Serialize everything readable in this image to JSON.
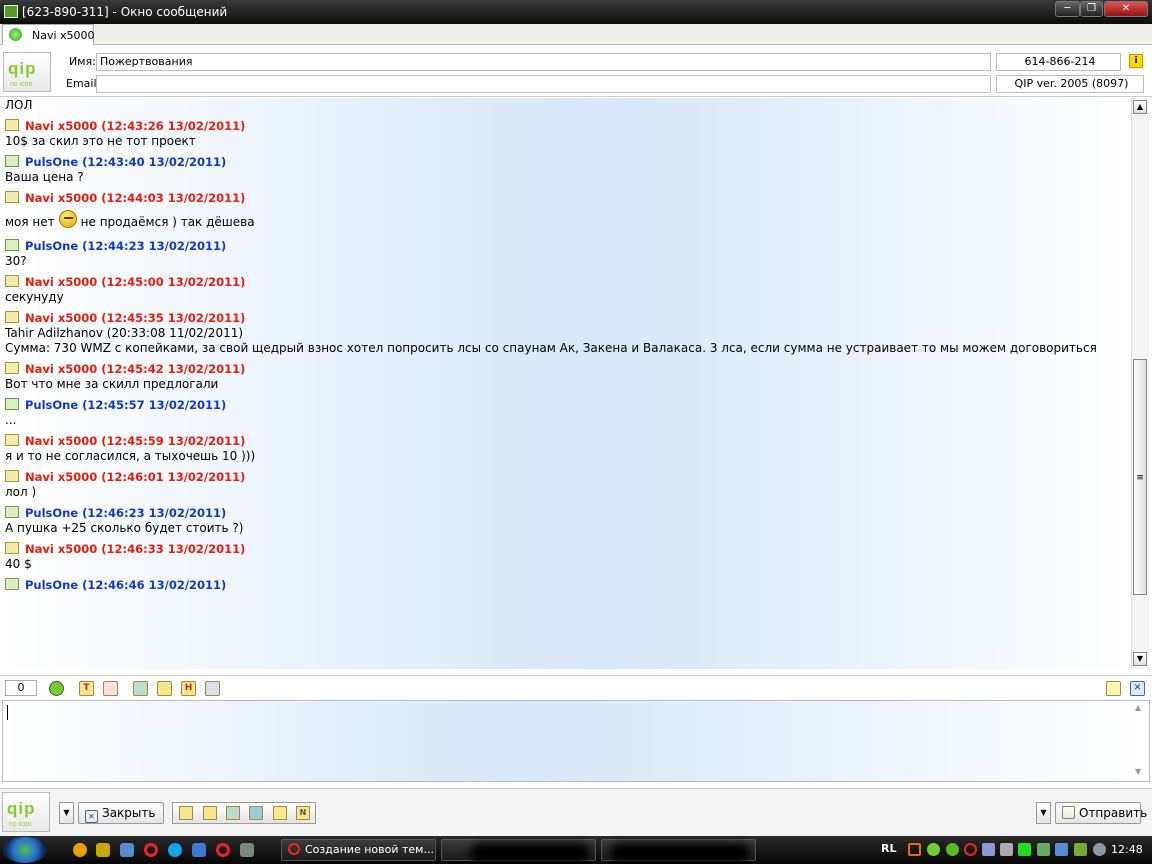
{
  "window": {
    "title": "[623-890-311] - Окно сообщений"
  },
  "tabs": [
    {
      "label": "Navi x5000"
    }
  ],
  "contact": {
    "name_label": "Имя:",
    "name_value": "Пожертвования",
    "email_label": "Email:",
    "email_value": "",
    "uin": "614-866-214",
    "client_version": "QIP ver. 2005 (8097)"
  },
  "logo": {
    "text": "qip",
    "subtitle": "no icon"
  },
  "messages": [
    {
      "type": "text",
      "text": "ЛОЛ"
    },
    {
      "type": "header",
      "sender": "navi",
      "text": "Navi x5000 (12:43:26 13/02/2011)"
    },
    {
      "type": "text",
      "text": "10$ за скил это не тот проект"
    },
    {
      "type": "header",
      "sender": "puls",
      "text": "PulsOne (12:43:40 13/02/2011)"
    },
    {
      "type": "text",
      "text": "Ваша цена ?"
    },
    {
      "type": "header",
      "sender": "navi",
      "text": "Navi x5000 (12:44:03 13/02/2011)"
    },
    {
      "type": "smile",
      "before": "моя нет",
      "after": "не продаёмся ) так дёшева"
    },
    {
      "type": "header",
      "sender": "puls",
      "text": "PulsOne (12:44:23 13/02/2011)"
    },
    {
      "type": "text",
      "text": "30?"
    },
    {
      "type": "header",
      "sender": "navi",
      "text": "Navi x5000 (12:45:00 13/02/2011)"
    },
    {
      "type": "text",
      "text": "секунуду"
    },
    {
      "type": "header",
      "sender": "navi",
      "text": "Navi x5000 (12:45:35 13/02/2011)"
    },
    {
      "type": "text",
      "text": "Tahir Adilzhanov (20:33:08 11/02/2011)"
    },
    {
      "type": "text",
      "text": "Сумма: 730 WMZ с копейками, за свой щедрый взнос хотел попросить лсы со спаунам Ак, Закена и Валакаса. 3 лса, если сумма не устраивает то мы можем договориться"
    },
    {
      "type": "header",
      "sender": "navi",
      "text": "Navi x5000 (12:45:42 13/02/2011)"
    },
    {
      "type": "text",
      "text": "Вот что мне за скилл предлогали"
    },
    {
      "type": "header",
      "sender": "puls",
      "text": "PulsOne (12:45:57 13/02/2011)"
    },
    {
      "type": "text",
      "text": "..."
    },
    {
      "type": "header",
      "sender": "navi",
      "text": "Navi x5000 (12:45:59 13/02/2011)"
    },
    {
      "type": "text",
      "text": "я и то не согласился, а тыхочешь 10 )))"
    },
    {
      "type": "header",
      "sender": "navi",
      "text": "Navi x5000 (12:46:01 13/02/2011)"
    },
    {
      "type": "text",
      "text": "лол )"
    },
    {
      "type": "header",
      "sender": "puls",
      "text": "PulsOne (12:46:23 13/02/2011)"
    },
    {
      "type": "text",
      "text": "А пушка +25 сколько будет стоить ?)"
    },
    {
      "type": "header",
      "sender": "navi",
      "text": "Navi x5000 (12:46:33 13/02/2011)"
    },
    {
      "type": "text",
      "text": "40 $"
    },
    {
      "type": "header",
      "sender": "puls",
      "text": "PulsOne (12:46:46 13/02/2011)"
    }
  ],
  "toolbar": {
    "counter": "0"
  },
  "buttons": {
    "close": "Закрыть",
    "send": "Отправить"
  },
  "taskbar": {
    "task1": "Создание новой тем...",
    "language": "RL",
    "clock": "12:48"
  },
  "colors": {
    "navi": "#e81c0c",
    "puls": "#1038c8",
    "qip_green": "#88cc33"
  }
}
